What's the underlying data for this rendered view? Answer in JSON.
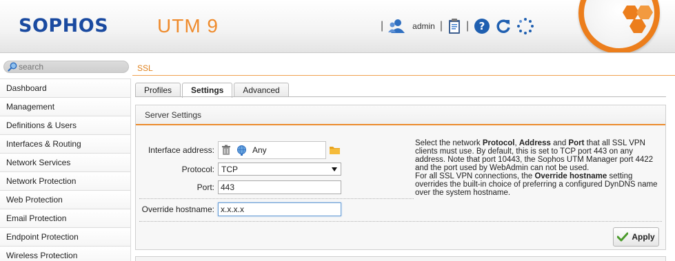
{
  "header": {
    "brand": "SOPHOS",
    "product": "UTM 9",
    "separator": "|",
    "user": "admin",
    "icons": [
      "user-icon",
      "clipboard-icon",
      "help-icon",
      "reload-icon",
      "activity-spinner-icon"
    ]
  },
  "colors": {
    "accent": "#ec7e1c",
    "brand_blue": "#1a4aa0",
    "link_orange": "#e0821e"
  },
  "sidebar": {
    "search_placeholder": "search",
    "items": [
      {
        "label": "Dashboard"
      },
      {
        "label": "Management"
      },
      {
        "label": "Definitions & Users"
      },
      {
        "label": "Interfaces & Routing"
      },
      {
        "label": "Network Services"
      },
      {
        "label": "Network Protection"
      },
      {
        "label": "Web Protection"
      },
      {
        "label": "Email Protection"
      },
      {
        "label": "Endpoint Protection"
      },
      {
        "label": "Wireless Protection"
      }
    ]
  },
  "main": {
    "breadcrumb": "SSL",
    "tabs": [
      {
        "label": "Profiles",
        "active": false
      },
      {
        "label": "Settings",
        "active": true
      },
      {
        "label": "Advanced",
        "active": false
      }
    ],
    "panel": {
      "title": "Server Settings",
      "fields": {
        "interface_label": "Interface address:",
        "interface_value": "Any",
        "protocol_label": "Protocol:",
        "protocol_value": "TCP",
        "port_label": "Port:",
        "port_value": "443",
        "override_label": "Override hostname:",
        "override_value": "x.x.x.x"
      },
      "help": {
        "p1_a": "Select the network ",
        "p1_b1": "Protocol",
        "p1_c": ", ",
        "p1_b2": "Address",
        "p1_d": " and ",
        "p1_b3": "Port",
        "p1_e": " that all SSL VPN clients must use. By default, this is set to TCP port 443 on any address. Note that port 10443, the Sophos UTM Manager port 4422 and the port used by WebAdmin can not be used.",
        "p2_a": "For all SSL VPN connections, the ",
        "p2_b": "Override hostname",
        "p2_c": " setting overrides the built-in choice of preferring a configured DynDNS name over the system hostname."
      },
      "apply_label": "Apply"
    }
  }
}
